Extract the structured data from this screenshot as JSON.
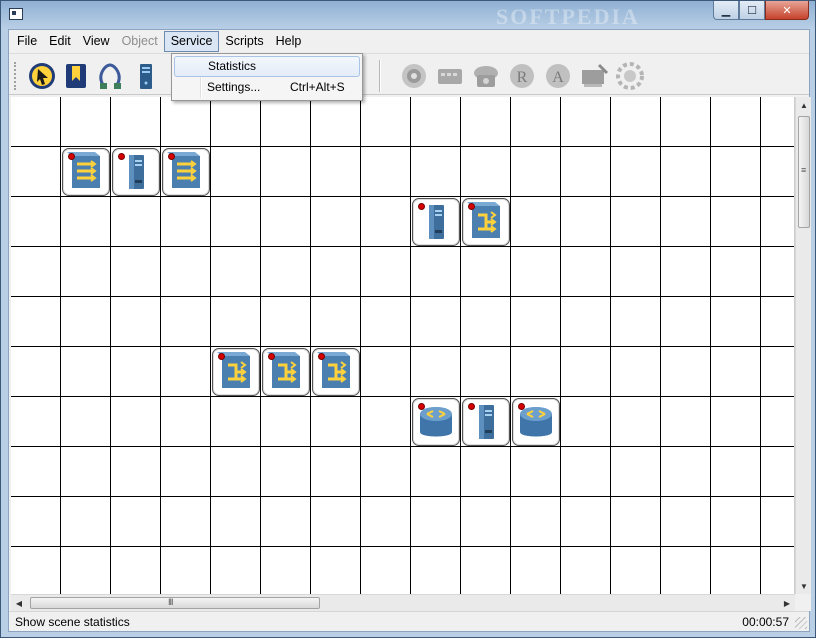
{
  "window": {
    "watermark": "SOFTPEDIA",
    "minimize_glyph": "▁",
    "maximize_glyph": "☐",
    "close_glyph": "✕"
  },
  "menu": {
    "items": [
      {
        "label": "File",
        "enabled": true
      },
      {
        "label": "Edit",
        "enabled": true
      },
      {
        "label": "View",
        "enabled": true
      },
      {
        "label": "Object",
        "enabled": false
      },
      {
        "label": "Service",
        "enabled": true,
        "active": true
      },
      {
        "label": "Scripts",
        "enabled": true
      },
      {
        "label": "Help",
        "enabled": true
      }
    ]
  },
  "service_menu": {
    "items": [
      {
        "label": "Statistics",
        "shortcut": "",
        "highlighted": true
      },
      {
        "label": "Settings...",
        "shortcut": "Ctrl+Alt+S",
        "highlighted": false
      }
    ]
  },
  "toolbar": {
    "buttons": [
      {
        "icon": "pointer-icon",
        "enabled": true
      },
      {
        "icon": "bookmark-icon",
        "enabled": true
      },
      {
        "icon": "cable-icon",
        "enabled": true
      },
      {
        "icon": "computer-icon",
        "enabled": true
      },
      {
        "icon": "gear-disabled-icon",
        "enabled": false
      },
      {
        "icon": "switch-disabled-icon",
        "enabled": false
      },
      {
        "icon": "phone-disabled-icon",
        "enabled": false
      },
      {
        "icon": "router-r-disabled-icon",
        "enabled": false
      },
      {
        "icon": "router-a-disabled-icon",
        "enabled": false
      },
      {
        "icon": "network-card-disabled-icon",
        "enabled": false
      },
      {
        "icon": "settings-disabled-icon",
        "enabled": false
      }
    ]
  },
  "canvas": {
    "nodes": [
      {
        "type": "switch",
        "col": 1,
        "row": 1
      },
      {
        "type": "computer",
        "col": 2,
        "row": 1
      },
      {
        "type": "switch",
        "col": 3,
        "row": 1
      },
      {
        "type": "computer",
        "col": 8,
        "row": 2
      },
      {
        "type": "hub",
        "col": 9,
        "row": 2
      },
      {
        "type": "hub",
        "col": 4,
        "row": 5
      },
      {
        "type": "hub",
        "col": 5,
        "row": 5
      },
      {
        "type": "hub",
        "col": 6,
        "row": 5
      },
      {
        "type": "router",
        "col": 8,
        "row": 6
      },
      {
        "type": "computer",
        "col": 9,
        "row": 6
      },
      {
        "type": "router",
        "col": 10,
        "row": 6
      }
    ]
  },
  "scrollbars": {
    "up": "▲",
    "down": "▼",
    "left": "◀",
    "right": "▶",
    "grip_v": "≡",
    "grip_h": "III"
  },
  "status": {
    "message": "Show scene statistics",
    "time": "00:00:57"
  },
  "colors": {
    "node_indicator": "#d60000",
    "grid_line": "#000000",
    "menu_highlight": "#dbe6f4"
  }
}
